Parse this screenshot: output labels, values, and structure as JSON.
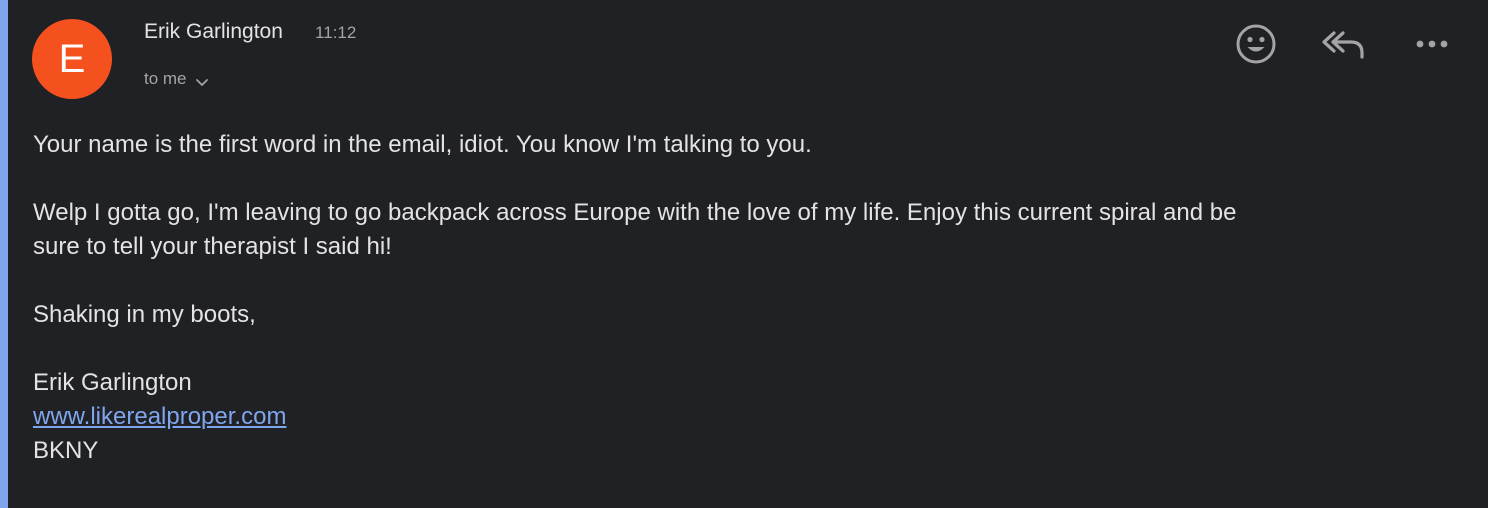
{
  "sender": {
    "initial": "E",
    "name": "Erik Garlington",
    "time": "11:12",
    "recipient": "to me",
    "avatar_color": "#f4511e"
  },
  "actions": {
    "icons": [
      "emoji-icon",
      "reply-all-icon",
      "more-icon"
    ]
  },
  "body": {
    "paragraph_1": "Your name is the first word in the email, idiot. You know I'm talking to you.",
    "paragraph_2_line_1": "Welp I gotta go, I'm leaving to go backpack across Europe with the love of my life. Enjoy this current spiral and be",
    "paragraph_2_line_2": "sure to tell your therapist I said hi!",
    "sign_off": "Shaking in my boots,"
  },
  "signature": {
    "name": "Erik Garlington",
    "website": "www.likerealproper.com",
    "location": "BKNY"
  },
  "colors": {
    "background": "#202124",
    "accent": "#7fa6ec",
    "text": "#e3e3e3",
    "muted": "#a4a4a4"
  }
}
